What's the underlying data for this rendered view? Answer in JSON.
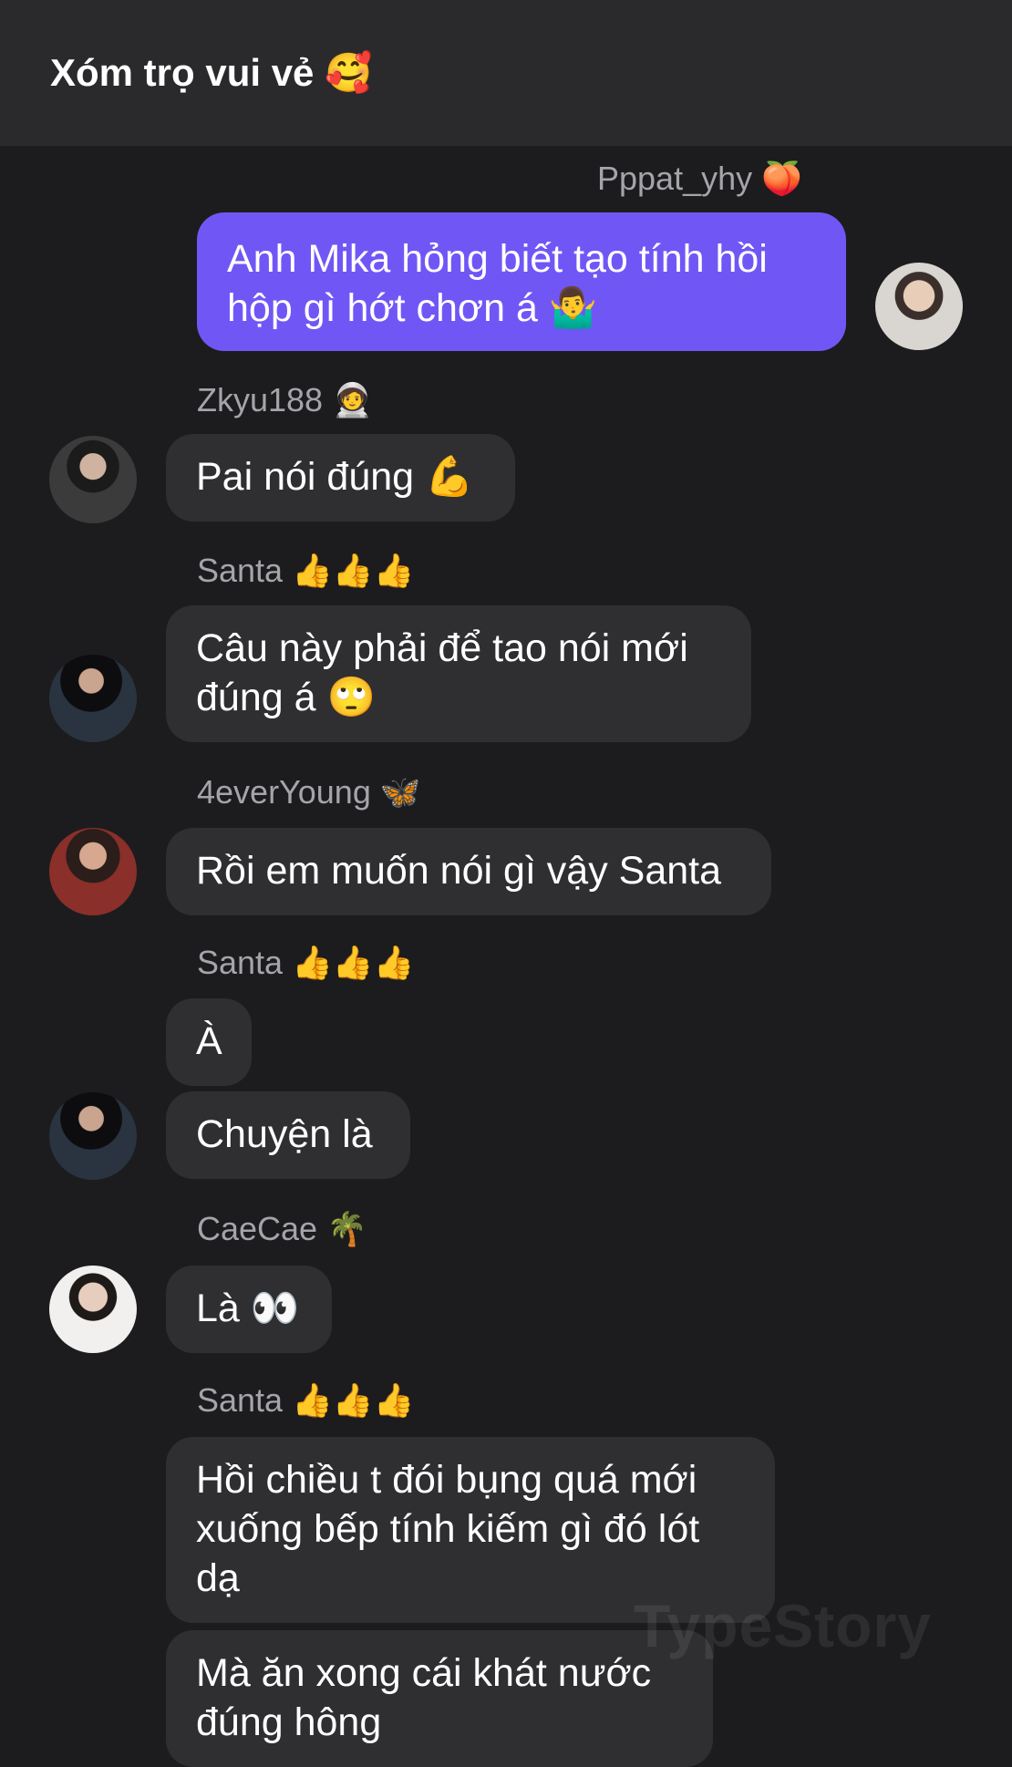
{
  "header": {
    "title": "Xóm trọ vui vẻ 🥰"
  },
  "messages": [
    {
      "sender": "Pppat_yhy 🍑",
      "text": "Anh Mika hỏng biết tạo tính hồi hộp gì hớt chơn á 🤷‍♂️"
    },
    {
      "sender": "Zkyu188 🧑‍🚀",
      "text": "Pai nói đúng 💪"
    },
    {
      "sender": "Santa 👍👍👍",
      "text": "Câu này phải để tao nói mới đúng á 🙄"
    },
    {
      "sender": "4everYoung 🦋",
      "text": "Rồi em muốn nói gì vậy Santa"
    },
    {
      "sender": "Santa 👍👍👍",
      "text": "À"
    },
    {
      "text": "Chuyện là"
    },
    {
      "sender": "CaeCae 🌴",
      "text": "Là 👀"
    },
    {
      "sender": "Santa 👍👍👍",
      "text": "Hồi chiều t đói bụng quá mới xuống bếp tính kiếm gì đó lót dạ"
    },
    {
      "text": "Mà ăn xong cái khát nước đúng hông"
    }
  ],
  "watermark": "TypeStory"
}
